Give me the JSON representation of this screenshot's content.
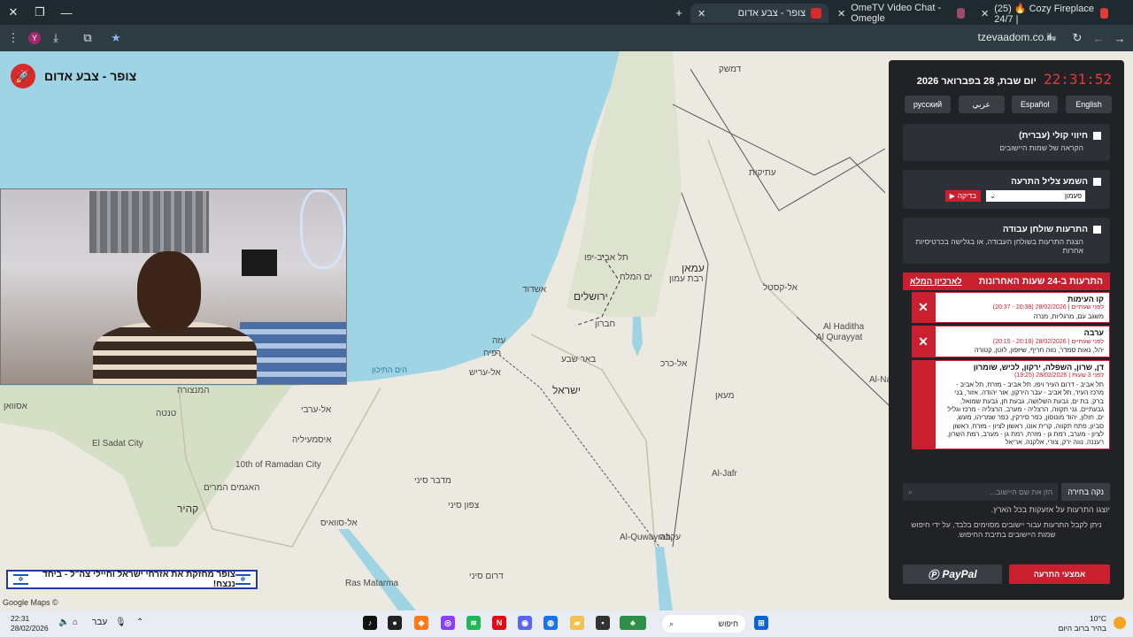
{
  "browser": {
    "tabs": [
      {
        "title": "(25) 🔥 Cozy Fireplace 24/7 |",
        "favicon_color": "#e53935"
      },
      {
        "title": "OmeTV Video Chat - Omegle",
        "favicon_color": "#9c4b6f"
      },
      {
        "title": "צופר - צבע אדום",
        "favicon_color": "#d52b2b",
        "active": true
      }
    ],
    "url": "tzevaadom.co.il"
  },
  "site": {
    "logo_text": "🚀",
    "title": "צופר - צבע אדום"
  },
  "map": {
    "labels": [
      "דמשק",
      "ירושלים",
      "תל אביב-יפו",
      "עמאן",
      "אשדוד",
      "ים המלח",
      "חברון",
      "באר שבע",
      "ישראל",
      "מדבר סיני",
      "צפון סיני",
      "אסוואן",
      "קהיר",
      "המנצורה",
      "טנטה",
      "אל-ערבי",
      "האגמים המרים",
      "איסמעיליה",
      "10th of Ramadan City",
      "El Sadat City",
      "אל-סוואיס",
      "עקבה",
      "Al-Jafr",
      "Al-Quwayrah",
      "Ras Matarma",
      "רפיח",
      "עזה",
      "אל-עריש",
      "Al Haditha",
      "Al-Nas",
      "אל-קסטל",
      "מעאן",
      "אל-כרכ",
      "עתיקות",
      "הים התיכון",
      "דרום סיני",
      "רבת עמון",
      "Al Qurayyat"
    ],
    "banner_text": "צופר מחזקת את אזרחי ישראל וחיילי צה\"ל - ביחד ננצח!",
    "attribution": "Google Maps ©"
  },
  "panel": {
    "clock": "22:31:52",
    "date": "יום שבת, 28 בפברואר 2026",
    "languages": [
      "русский",
      "عربي",
      "Español",
      "English"
    ],
    "voice": {
      "title": "חיווי קולי (עברית)",
      "subtitle": "הקראה של שמות היישובים"
    },
    "sound": {
      "title": "השמע צליל התרעה",
      "select_value": "פעמון",
      "test_label": "בדיקה"
    },
    "desktop": {
      "title": "התרעות שולחן עבודה",
      "subtitle": "הצגת התרעות בשולחן העבודה, או בגלישה בכרטיסיות אחרות"
    },
    "alerts_title": "התרעות ב-24 שעות האחרונות",
    "archive_link": "לארכיון המלא",
    "alerts": [
      {
        "city": "קו העימות",
        "time": "לפני שעתיים | 28/02/2026 (20:38 - 20:37)",
        "area": "משגב עם, מרגליות, מנרה"
      },
      {
        "city": "ערבה",
        "time": "לפני שעתיים | 28/02/2026 (20:18 - 20:15)",
        "area": "יהל, נאות סמדר, נווה חריף, שיזפון, לוטן, קטורה"
      },
      {
        "city": "דן, שרון, השפלה, ירקון, לכיש, שומרון",
        "time": "לפני 3 שעות | 28/02/2026 (19:25)",
        "area": "תל אביב - דרום העיר ויפו, תל אביב - מזרח, תל אביב - מרכז העיר, תל אביב - עבר הירקון, אור יהודה, אזור, בני ברק, בת ים, גבעת השלושה, גבעת חן, גבעת שמואל, גבעתיים, גני תקווה, הרצליה - מערב, הרצליה - מרכז וגליל ים, חולון, יהוד מונוסון, כפר סירקין, כפר שמריהו, מעש, סביון, פתח תקווה, קרית אונו, ראשון לציון - מזרח, ראשון לציון - מערב, רמת גן - מזרח, רמת גן - מערב, רמת השרון, רעננה, נווה ירק, צורי, אלקנה, אריאל"
      }
    ],
    "clear_label": "נקה בחירה",
    "search_placeholder": "הזן את שם היישוב...",
    "note1": "יוצגו התרעות על אזעקות בכל הארץ.",
    "note2": "ניתן לקבל התרעות עבור יישובים מסוימים בלבד, על ידי חיפוש שמות היישובים בתיבת החיפוש.",
    "paypal_label": "PayPal",
    "ways_label": "אמצעי התרעה"
  },
  "taskbar": {
    "time": "22:31",
    "date": "28/02/2026",
    "lang": "עבר",
    "search": "חיפוש",
    "weather_temp": "10°C",
    "weather_desc": "בהיר ברוב היום"
  }
}
